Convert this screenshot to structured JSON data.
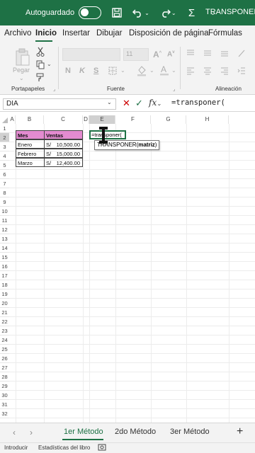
{
  "titlebar": {
    "autosave_label": "Autoguardado",
    "file_title": "TRANSPONER DA"
  },
  "tabs": [
    "Archivo",
    "Inicio",
    "Insertar",
    "Dibujar",
    "Disposición de página",
    "Fórmulas"
  ],
  "ribbon": {
    "paste_label": "Pegar",
    "font_size": "11",
    "bold": "N",
    "italic": "K",
    "underline": "S",
    "groups": {
      "clipboard": "Portapapeles",
      "font": "Fuente",
      "alignment": "Alineación"
    }
  },
  "formula_bar": {
    "name_box": "DIA",
    "fx": "fx",
    "formula": "=transponer("
  },
  "columns": [
    "A",
    "B",
    "C",
    "D",
    "E",
    "F",
    "G",
    "H"
  ],
  "rows": [
    "1",
    "2",
    "3",
    "4",
    "5",
    "6",
    "7",
    "8",
    "9",
    "10",
    "11",
    "12",
    "13",
    "14",
    "15",
    "16",
    "17",
    "18",
    "19",
    "20",
    "21",
    "22",
    "23",
    "24",
    "25",
    "26",
    "27",
    "28",
    "29",
    "30",
    "31",
    "32"
  ],
  "table": {
    "headers": [
      "Mes",
      "Ventas"
    ],
    "rows": [
      {
        "mes": "Enero",
        "currency": "S/",
        "value": "10,500.00"
      },
      {
        "mes": "Febrero",
        "currency": "S/",
        "value": "15,000.00"
      },
      {
        "mes": "Marzo",
        "currency": "S/",
        "value": "12,400.00"
      }
    ]
  },
  "editing_cell": {
    "text": "=transponer("
  },
  "tooltip": {
    "func": "TRANSPONER(",
    "arg": "matriz",
    ")": ")"
  },
  "sheets": [
    "1er Método",
    "2do Método",
    "3er Método"
  ],
  "status": {
    "mode": "Introducir",
    "stats": "Estadísticas del libro"
  },
  "colors": {
    "brand": "#1e7145",
    "header_fill": "#e38bd0"
  }
}
